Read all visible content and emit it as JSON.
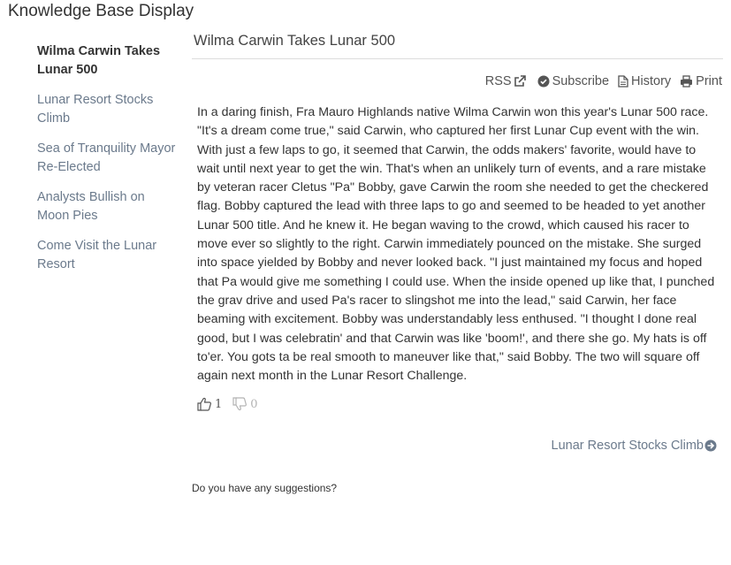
{
  "app_title": "Knowledge Base Display",
  "sidebar": {
    "items": [
      {
        "label": "Wilma Carwin Takes Lunar 500",
        "active": true
      },
      {
        "label": "Lunar Resort Stocks Climb",
        "active": false
      },
      {
        "label": "Sea of Tranquility Mayor Re-Elected",
        "active": false
      },
      {
        "label": "Analysts Bullish on Moon Pies",
        "active": false
      },
      {
        "label": "Come Visit the Lunar Resort",
        "active": false
      }
    ]
  },
  "article": {
    "title": "Wilma Carwin Takes Lunar 500",
    "body": "In a daring finish, Fra Mauro Highlands native Wilma Carwin won this year's Lunar 500 race. \"It's a dream come true,\" said Carwin, who captured her first Lunar Cup event with the win. With just a few laps to go, it seemed that Carwin, the odds makers' favorite, would have to wait until next year to get the win. That's when an unlikely turn of events, and a rare mistake by veteran racer Cletus \"Pa\" Bobby, gave Carwin the room she needed to get the checkered flag. Bobby captured the lead with three laps to go and seemed to be headed to yet another Lunar 500 title. And he knew it. He began waving to the crowd, which caused his racer to move ever so slightly to the right. Carwin immediately pounced on the mistake. She surged into space yielded by Bobby and never looked back. \"I just maintained my focus and hoped that Pa would give me something I could use. When the inside opened up like that, I punched the grav drive and used Pa's racer to slingshot me into the lead,\" said Carwin, her face beaming with excitement. Bobby was understandably less enthused. \"I thought I done real good, but I was celebratin' and that Carwin was like 'boom!', and there she go. My hats is off to'er. You gots ta be real smooth to maneuver like that,\" said Bobby. The two will square off again next month in the Lunar Resort Challenge."
  },
  "toolbar": {
    "rss_label": "RSS",
    "subscribe_label": "Subscribe",
    "history_label": "History",
    "print_label": "Print"
  },
  "votes": {
    "up_count": "1",
    "down_count": "0"
  },
  "next_article": {
    "label": "Lunar Resort Stocks Climb"
  },
  "suggestions_prompt": "Do you have any suggestions?",
  "colors": {
    "link": "#6b7a8c",
    "text": "#333333",
    "muted": "#b3b3b3"
  },
  "icons": [
    "external-link-icon",
    "check-circle-icon",
    "document-icon",
    "printer-icon",
    "thumbs-up-icon",
    "thumbs-down-icon",
    "arrow-circle-right-icon"
  ]
}
